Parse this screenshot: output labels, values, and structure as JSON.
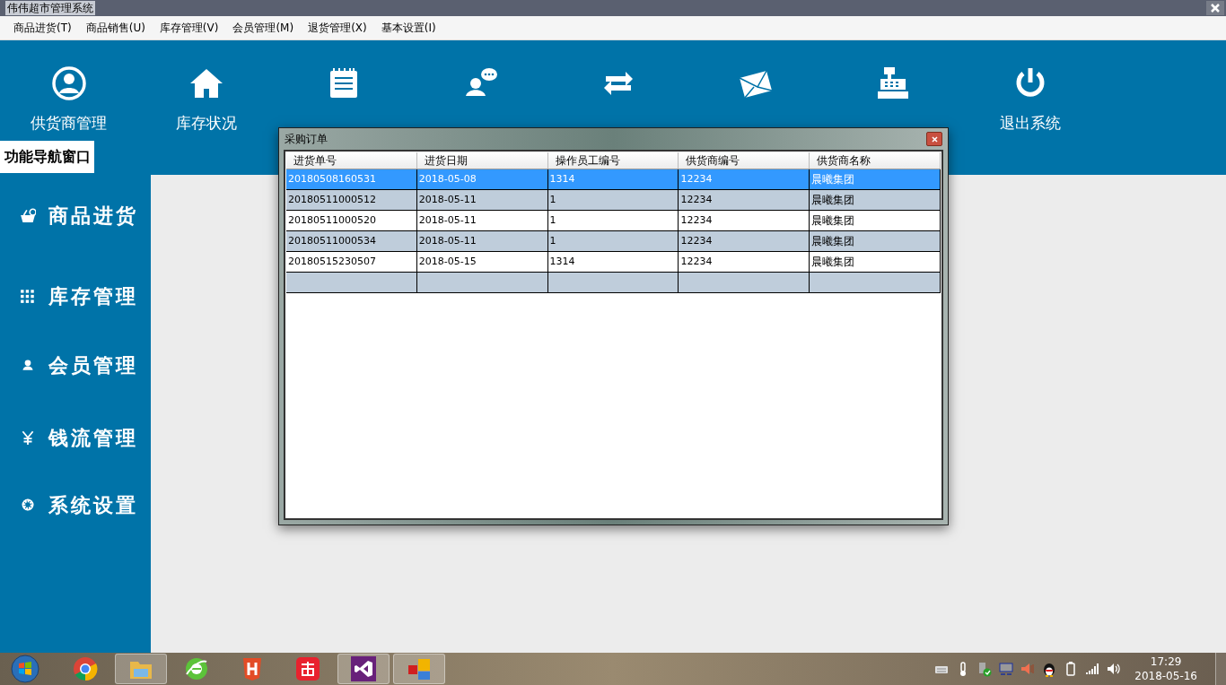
{
  "window": {
    "title": "伟伟超市管理系统"
  },
  "menu_bar": [
    "商品进货(T)",
    "商品销售(U)",
    "库存管理(V)",
    "会员管理(M)",
    "退货管理(X)",
    "基本设置(I)"
  ],
  "toolbar": [
    {
      "kind": "person",
      "label": "供货商管理"
    },
    {
      "kind": "house",
      "label": "库存状况"
    },
    {
      "kind": "notepad"
    },
    {
      "kind": "chat"
    },
    {
      "kind": "swap"
    },
    {
      "kind": "mail"
    },
    {
      "kind": "register"
    },
    {
      "kind": "power",
      "label": "退出系统"
    }
  ],
  "nav_tab": "功能导航窗口",
  "sidebar": [
    {
      "kind": "basket",
      "label": "商品进货"
    },
    {
      "kind": "grid",
      "label": "库存管理"
    },
    {
      "kind": "user",
      "label": "会员管理"
    },
    {
      "kind": "yen",
      "label": "钱流管理"
    },
    {
      "kind": "gear",
      "label": "系统设置"
    }
  ],
  "dialog": {
    "title": "采购订单",
    "columns": [
      "进货单号",
      "进货日期",
      "操作员工编号",
      "供货商编号",
      "供货商名称"
    ],
    "rows": [
      {
        "selected": true,
        "cells": [
          "20180508160531",
          "2018-05-08",
          "1314",
          "12234",
          "晨曦集团"
        ]
      },
      {
        "selected": false,
        "cells": [
          "20180511000512",
          "2018-05-11",
          "1",
          "12234",
          "晨曦集团"
        ]
      },
      {
        "selected": false,
        "cells": [
          "20180511000520",
          "2018-05-11",
          "1",
          "12234",
          "晨曦集团"
        ]
      },
      {
        "selected": false,
        "cells": [
          "20180511000534",
          "2018-05-11",
          "1",
          "12234",
          "晨曦集团"
        ]
      },
      {
        "selected": false,
        "cells": [
          "20180515230507",
          "2018-05-15",
          "1314",
          "12234",
          "晨曦集团"
        ]
      }
    ]
  },
  "taskbar": {
    "apps": [
      {
        "kind": "chrome",
        "active": false
      },
      {
        "kind": "folder",
        "active": true
      },
      {
        "kind": "browser",
        "active": false
      },
      {
        "kind": "h",
        "active": false
      },
      {
        "kind": "dict",
        "active": false
      },
      {
        "kind": "vs",
        "active": true
      },
      {
        "kind": "tiles",
        "active": true
      }
    ],
    "time": "17:29",
    "date": "2018-05-16"
  }
}
